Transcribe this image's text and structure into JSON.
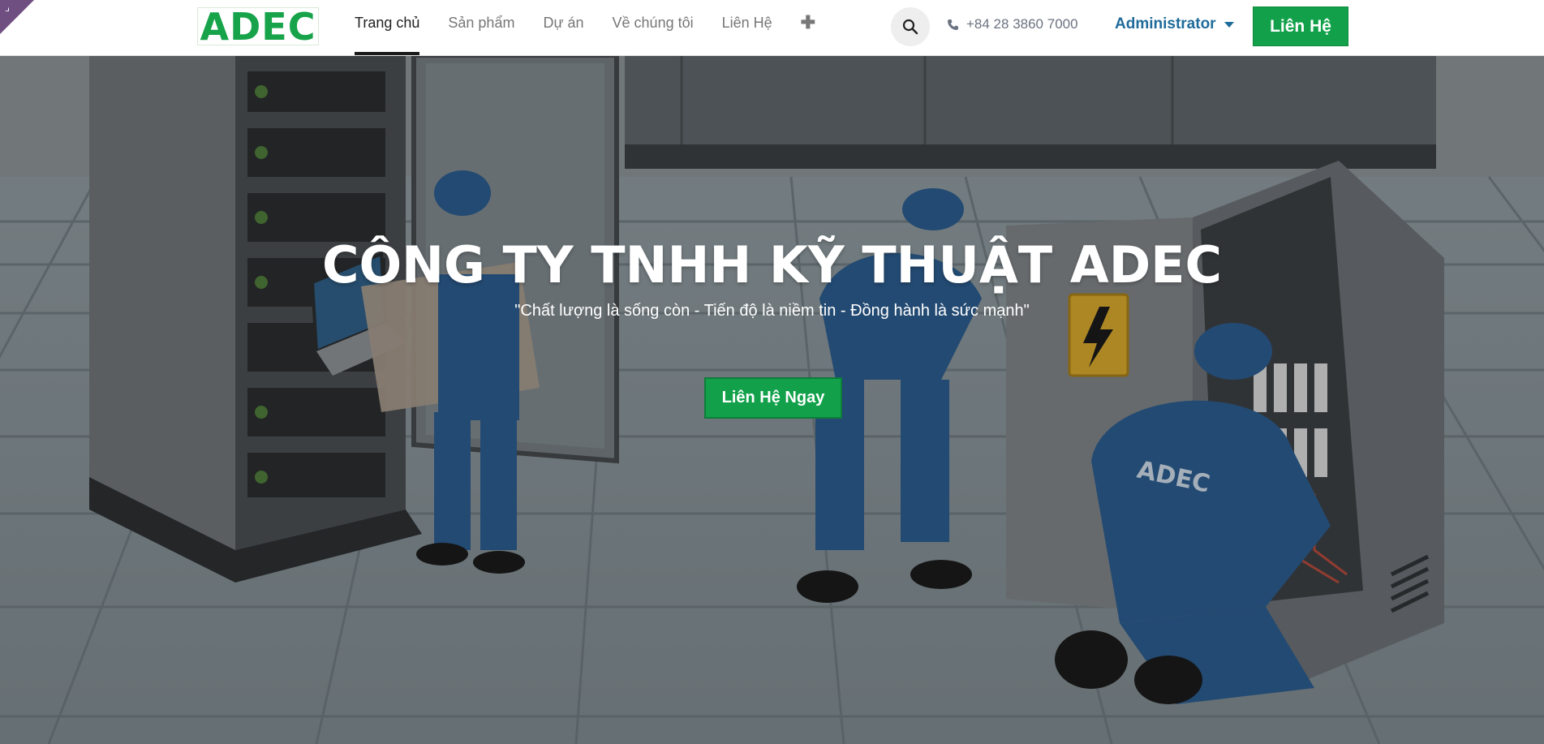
{
  "corner": {
    "glyph": "⌟",
    "color": "#6f4f82"
  },
  "logo": {
    "text": "ADEC",
    "color": "#16a34a"
  },
  "nav": {
    "items": [
      {
        "label": "Trang chủ",
        "active": true
      },
      {
        "label": "Sản phẩm",
        "active": false
      },
      {
        "label": "Dự án",
        "active": false
      },
      {
        "label": "Về chúng tôi",
        "active": false
      },
      {
        "label": "Liên Hệ",
        "active": false
      }
    ],
    "add_icon": "✚"
  },
  "search": {
    "icon": "search-icon"
  },
  "phone": {
    "icon": "phone-icon",
    "number": "+84 28 3860 7000"
  },
  "user": {
    "name": "Administrator",
    "color": "#1f6b9a"
  },
  "header_cta": {
    "label": "Liên Hệ",
    "color": "#12a14a"
  },
  "hero": {
    "title": "CÔNG TY TNHH KỸ THUẬT ADEC",
    "subtitle": "\"Chất lượng là sống còn - Tiến độ là niềm tin - Đồng hành là sức mạnh\"",
    "cta_label": "Liên Hệ Ngay",
    "worker_badge": "ADEC",
    "colors": {
      "uniform": "#2b5b8c",
      "button": "#12a14a"
    }
  }
}
